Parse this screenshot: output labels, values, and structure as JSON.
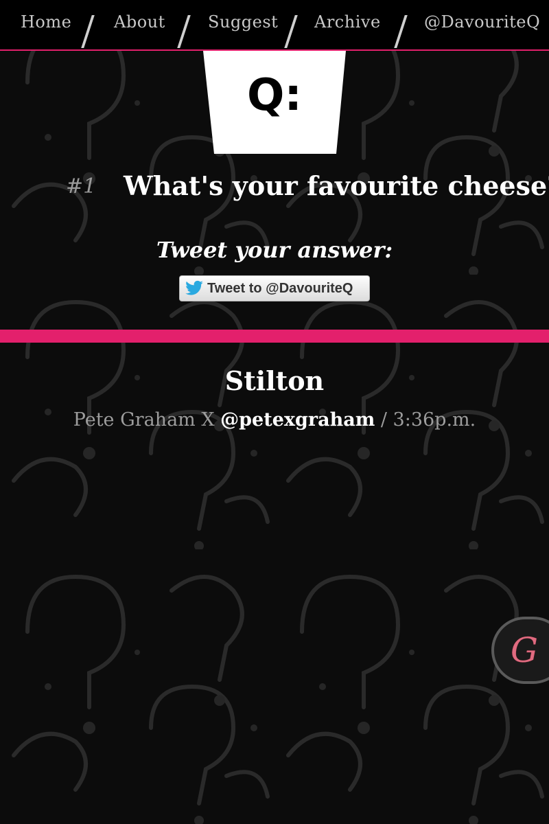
{
  "nav": {
    "items": [
      {
        "label": "Home"
      },
      {
        "label": "About"
      },
      {
        "label": "Suggest"
      },
      {
        "label": "Archive"
      },
      {
        "label": "@DavouriteQ"
      }
    ]
  },
  "logo": {
    "text": "Q:"
  },
  "question": {
    "number": "#1",
    "text": "What's your favourite cheese?"
  },
  "tweet": {
    "prompt": "Tweet your answer:",
    "button_label": "Tweet to @DavouriteQ"
  },
  "answer": {
    "text": "Stilton",
    "author": "Pete Graham X",
    "handle": "@petexgraham",
    "time_sep": " / ",
    "time": "3:36p.m."
  },
  "side_badge": {
    "letter": "G"
  },
  "colors": {
    "accent": "#e3206c",
    "background": "#0c0c0c",
    "nav_text": "#c8c8c8"
  },
  "icons": [
    "twitter-bird-icon",
    "question-mark-pattern"
  ]
}
